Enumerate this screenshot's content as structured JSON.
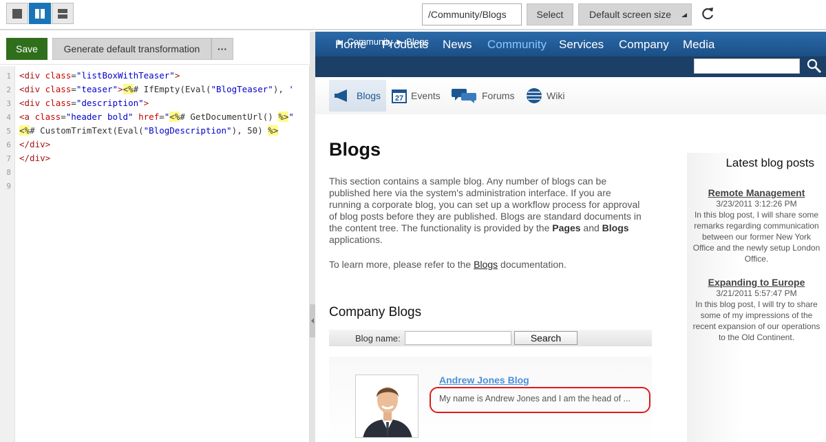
{
  "toolbar": {
    "path_value": "/Community/Blogs",
    "select_label": "Select",
    "screen_size_label": "Default screen size"
  },
  "editor": {
    "save_label": "Save",
    "generate_label": "Generate default transformation",
    "more_label": "···",
    "line_numbers": [
      "1",
      "2",
      "3",
      "4",
      "5",
      "6",
      "7",
      "8",
      "9"
    ]
  },
  "site": {
    "nav": [
      "Home",
      "Products",
      "News",
      "Community",
      "Services",
      "Company",
      "Media"
    ],
    "breadcrumb": "► Community ► Blogs",
    "subtabs": [
      {
        "label": "Blogs",
        "icon": "megaphone-icon"
      },
      {
        "label": "Events",
        "icon": "calendar-icon",
        "day": "27"
      },
      {
        "label": "Forums",
        "icon": "speech-bubbles-icon"
      },
      {
        "label": "Wiki",
        "icon": "globe-icon"
      }
    ],
    "heading": "Blogs",
    "intro_1": "This section contains a sample blog. Any number of blogs can be published here via the system's administration interface. If you are running a corporate blog, you can set up a workflow process for approval of blog posts before they are published. Blogs are standard documents in the content tree. The functionality is provided by the",
    "intro_pages": "Pages",
    "intro_and": "and",
    "intro_blogs": "Blogs",
    "intro_end": "applications.",
    "more_prefix": "To learn more, please refer to the",
    "more_link": "Blogs",
    "more_suffix": "documentation.",
    "company_blogs": "Company Blogs",
    "blog_name_label": "Blog name:",
    "search_label": "Search",
    "blog": {
      "title": "Andrew Jones Blog",
      "description": "My name is Andrew Jones and I am the head of ..."
    },
    "sidebar": {
      "title": "Latest blog posts",
      "posts": [
        {
          "title": "Remote Management",
          "date": "3/23/2011 3:12:26 PM",
          "text": "In this blog post, I will share some remarks regarding communication between our former New York Office and the newly setup London Office."
        },
        {
          "title": "Expanding to Europe",
          "date": "3/21/2011 5:57:47 PM",
          "text": "In this blog post, I will try to share some of my impressions of the recent expansion of our operations to the Old Continent."
        }
      ]
    }
  },
  "colors": {
    "accent": "#1a75b8",
    "save": "#2f6e1b",
    "nav_active": "#8cc6ff",
    "highlight_ring": "#e0191b"
  }
}
